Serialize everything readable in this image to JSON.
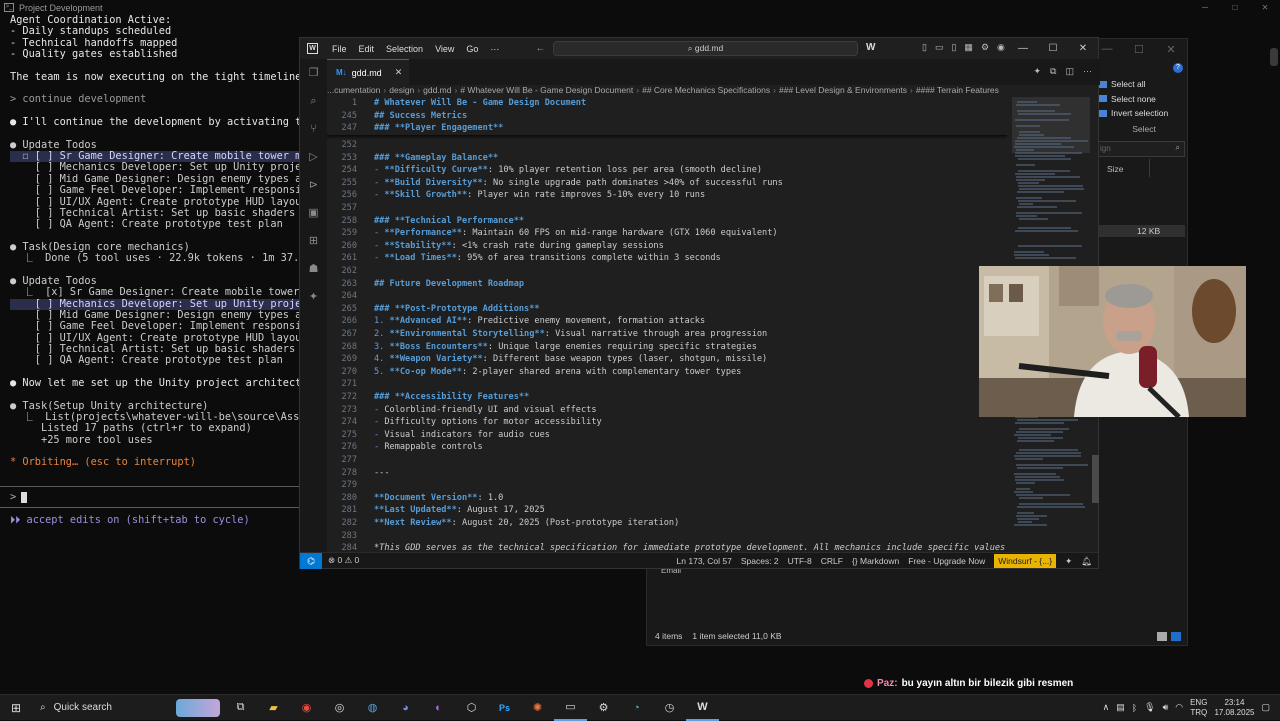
{
  "terminal": {
    "title": "Project Development",
    "lines": [
      {
        "text": "Agent Coordination Active:",
        "style": "white"
      },
      {
        "text": "- Daily standups scheduled",
        "style": "white"
      },
      {
        "text": "- Technical handoffs mapped",
        "style": "white"
      },
      {
        "text": "- Quality gates established",
        "style": "white"
      },
      {
        "text": "",
        "style": ""
      },
      {
        "text": "The team is now executing on the tight timeline with c",
        "style": "white"
      },
      {
        "text": "",
        "style": ""
      },
      {
        "text": "> continue development",
        "style": "dim"
      },
      {
        "text": "",
        "style": ""
      },
      {
        "text": "● I'll continue the development by activating the key ag",
        "style": "white"
      },
      {
        "text": "",
        "style": ""
      },
      {
        "text": "● Update Todos",
        "style": "green"
      },
      {
        "text": "  ☐ [ ] Sr Game Designer: Create mobile tower mechanics",
        "style": "hl"
      },
      {
        "text": "    [ ] Mechanics Developer: Set up Unity project archi",
        "style": ""
      },
      {
        "text": "    [ ] Mid Game Designer: Design enemy types and wave",
        "style": ""
      },
      {
        "text": "    [ ] Game Feel Developer: Implement responsive tower",
        "style": ""
      },
      {
        "text": "    [ ] UI/UX Agent: Create prototype HUD layout",
        "style": ""
      },
      {
        "text": "    [ ] Technical Artist: Set up basic shaders and visu",
        "style": ""
      },
      {
        "text": "    [ ] QA Agent: Create prototype test plan",
        "style": ""
      },
      {
        "text": "",
        "style": ""
      },
      {
        "text": "● Task(Design core mechanics)",
        "style": "green"
      },
      {
        "text": "  ⎿  Done (5 tool uses · 22.9k tokens · 1m 37.8s)",
        "style": ""
      },
      {
        "text": "",
        "style": ""
      },
      {
        "text": "● Update Todos",
        "style": "green"
      },
      {
        "text": "  ⎿  [x] Sr Game Designer: Create mobile tower mechanics",
        "style": "green"
      },
      {
        "text": "    [ ] Mechanics Developer: Set up Unity project archi",
        "style": "hl"
      },
      {
        "text": "    [ ] Mid Game Designer: Design enemy types and wave",
        "style": ""
      },
      {
        "text": "    [ ] Game Feel Developer: Implement responsive tower",
        "style": ""
      },
      {
        "text": "    [ ] UI/UX Agent: Create prototype HUD layout",
        "style": ""
      },
      {
        "text": "    [ ] Technical Artist: Set up basic shaders and visu",
        "style": ""
      },
      {
        "text": "    [ ] QA Agent: Create prototype test plan",
        "style": ""
      },
      {
        "text": "",
        "style": ""
      },
      {
        "text": "● Now let me set up the Unity project architecture:",
        "style": "white"
      },
      {
        "text": "",
        "style": ""
      },
      {
        "text": "● Task(Setup Unity architecture)",
        "style": "green"
      },
      {
        "text": "  ⎿  List(projects\\whatever-will-be\\source\\Assets\\Script",
        "style": ""
      },
      {
        "text": "     Listed 17 paths (ctrl+r to expand)",
        "style": ""
      },
      {
        "text": "     +25 more tool uses",
        "style": ""
      },
      {
        "text": "",
        "style": ""
      },
      {
        "text": "* Orbiting… (esc to interrupt)",
        "style": "orange"
      }
    ],
    "prompt_symbol": ">",
    "hint": "⏵⏵ accept edits on (shift+tab to cycle)"
  },
  "explorer": {
    "select_all": "Select all",
    "select_none": "Select none",
    "invert_selection": "Invert selection",
    "select_group": "Select",
    "search_placeholder": "ign",
    "size_header": "Size",
    "selected_size": "12 KB",
    "email_label": "Email",
    "status_items": "4 items",
    "status_selected": "1 item selected  11,0 KB"
  },
  "vscode": {
    "menu": [
      "File",
      "Edit",
      "Selection",
      "View",
      "Go",
      "···"
    ],
    "command_center": "⌕ gdd.md",
    "tab_label": "gdd.md",
    "breadcrumb": [
      "...cumentation",
      "design",
      "gdd.md",
      "# Whatever Will Be - Game Design Document",
      "## Core Mechanics Specifications",
      "### Level Design & Environments",
      "#### Terrain Features"
    ],
    "sticky_lines": [
      {
        "n": "1",
        "parts": [
          {
            "t": "# Whatever Will Be - Game Design Document",
            "c": "h"
          }
        ]
      },
      {
        "n": "245",
        "parts": [
          {
            "t": "## Success Metrics",
            "c": "h"
          }
        ]
      },
      {
        "n": "247",
        "parts": [
          {
            "t": "### **Player Engagement**",
            "c": "h"
          }
        ]
      }
    ],
    "lines": [
      {
        "n": "252",
        "parts": []
      },
      {
        "n": "253",
        "parts": [
          {
            "t": "### **Gameplay Balance**",
            "c": "h"
          }
        ]
      },
      {
        "n": "254",
        "parts": [
          {
            "t": "- ",
            "c": "li"
          },
          {
            "t": "**Difficulty Curve**",
            "c": "bb"
          },
          {
            "t": ": 10% player retention loss per area (smooth decline)",
            "c": "tx"
          }
        ]
      },
      {
        "n": "255",
        "parts": [
          {
            "t": "- ",
            "c": "li"
          },
          {
            "t": "**Build Diversity**",
            "c": "bb"
          },
          {
            "t": ": No single upgrade path dominates >40% of successful runs",
            "c": "tx"
          }
        ]
      },
      {
        "n": "256",
        "parts": [
          {
            "t": "- ",
            "c": "li"
          },
          {
            "t": "**Skill Growth**",
            "c": "bb"
          },
          {
            "t": ": Player win rate improves 5-10% every 10 runs",
            "c": "tx"
          }
        ]
      },
      {
        "n": "257",
        "parts": []
      },
      {
        "n": "258",
        "parts": [
          {
            "t": "### **Technical Performance**",
            "c": "h"
          }
        ]
      },
      {
        "n": "259",
        "parts": [
          {
            "t": "- ",
            "c": "li"
          },
          {
            "t": "**Performance**",
            "c": "bb"
          },
          {
            "t": ": Maintain 60 FPS on mid-range hardware (GTX 1060 equivalent)",
            "c": "tx"
          }
        ]
      },
      {
        "n": "260",
        "parts": [
          {
            "t": "- ",
            "c": "li"
          },
          {
            "t": "**Stability**",
            "c": "bb"
          },
          {
            "t": ": <1% crash rate during gameplay sessions",
            "c": "tx"
          }
        ]
      },
      {
        "n": "261",
        "parts": [
          {
            "t": "- ",
            "c": "li"
          },
          {
            "t": "**Load Times**",
            "c": "bb"
          },
          {
            "t": ": 95% of area transitions complete within 3 seconds",
            "c": "tx"
          }
        ]
      },
      {
        "n": "262",
        "parts": []
      },
      {
        "n": "263",
        "parts": [
          {
            "t": "## Future Development Roadmap",
            "c": "h"
          }
        ]
      },
      {
        "n": "264",
        "parts": []
      },
      {
        "n": "265",
        "parts": [
          {
            "t": "### **Post-Prototype Additions**",
            "c": "h"
          }
        ]
      },
      {
        "n": "266",
        "parts": [
          {
            "t": "1. ",
            "c": "li"
          },
          {
            "t": "**Advanced AI**",
            "c": "bb"
          },
          {
            "t": ": Predictive enemy movement, formation attacks",
            "c": "tx"
          }
        ]
      },
      {
        "n": "267",
        "parts": [
          {
            "t": "2. ",
            "c": "li"
          },
          {
            "t": "**Environmental Storytelling**",
            "c": "bb"
          },
          {
            "t": ": Visual narrative through area progression",
            "c": "tx"
          }
        ]
      },
      {
        "n": "268",
        "parts": [
          {
            "t": "3. ",
            "c": "li"
          },
          {
            "t": "**Boss Encounters**",
            "c": "bb"
          },
          {
            "t": ": Unique large enemies requiring specific strategies",
            "c": "tx"
          }
        ]
      },
      {
        "n": "269",
        "parts": [
          {
            "t": "4. ",
            "c": "li"
          },
          {
            "t": "**Weapon Variety**",
            "c": "bb"
          },
          {
            "t": ": Different base weapon types (laser, shotgun, missile)",
            "c": "tx"
          }
        ]
      },
      {
        "n": "270",
        "parts": [
          {
            "t": "5. ",
            "c": "li"
          },
          {
            "t": "**Co-op Mode**",
            "c": "bb"
          },
          {
            "t": ": 2-player shared arena with complementary tower types",
            "c": "tx"
          }
        ]
      },
      {
        "n": "271",
        "parts": []
      },
      {
        "n": "272",
        "parts": [
          {
            "t": "### **Accessibility Features**",
            "c": "h"
          }
        ]
      },
      {
        "n": "273",
        "parts": [
          {
            "t": "- ",
            "c": "li"
          },
          {
            "t": "Colorblind-friendly UI and visual effects",
            "c": "tx"
          }
        ]
      },
      {
        "n": "274",
        "parts": [
          {
            "t": "- ",
            "c": "li"
          },
          {
            "t": "Difficulty options for motor accessibility",
            "c": "tx"
          }
        ]
      },
      {
        "n": "275",
        "parts": [
          {
            "t": "- ",
            "c": "li"
          },
          {
            "t": "Visual indicators for audio cues",
            "c": "tx"
          }
        ]
      },
      {
        "n": "276",
        "parts": [
          {
            "t": "- ",
            "c": "li"
          },
          {
            "t": "Remappable controls",
            "c": "tx"
          }
        ]
      },
      {
        "n": "277",
        "parts": []
      },
      {
        "n": "278",
        "parts": [
          {
            "t": "---",
            "c": "tx"
          }
        ]
      },
      {
        "n": "279",
        "parts": []
      },
      {
        "n": "280",
        "parts": [
          {
            "t": "**Document Version**",
            "c": "bb"
          },
          {
            "t": ": 1.0",
            "c": "tx"
          }
        ]
      },
      {
        "n": "281",
        "parts": [
          {
            "t": "**Last Updated**",
            "c": "bb"
          },
          {
            "t": ": August 17, 2025",
            "c": "tx"
          }
        ]
      },
      {
        "n": "282",
        "parts": [
          {
            "t": "**Next Review**",
            "c": "bb"
          },
          {
            "t": ": August 20, 2025 (Post-prototype iteration)",
            "c": "tx"
          }
        ]
      },
      {
        "n": "283",
        "parts": []
      },
      {
        "n": "284",
        "parts": [
          {
            "t": "*This GDD serves as the technical specification for immediate prototype development. All mechanics include specific values",
            "c": "it"
          }
        ]
      }
    ],
    "status": {
      "problems": "⊗ 0 ⚠ 0",
      "position": "Ln 173, Col 57",
      "spaces": "Spaces: 2",
      "encoding": "UTF-8",
      "eol": "CRLF",
      "language": "{} Markdown",
      "upgrade": "Free - Upgrade Now",
      "windsurf": "Windsurf - {...}"
    }
  },
  "chat": {
    "user": "Paz:",
    "message": "bu yayın altın bir bilezik gibi resmen"
  },
  "taskbar": {
    "search": "Quick search",
    "lang_top": "ENG",
    "lang_bottom": "TRQ",
    "time": "23:14",
    "date": "17.08.2025"
  },
  "colors": {
    "accent": "#0078d4",
    "windsurf": "#e8b400",
    "terminal_green": "#3fbf5f",
    "terminal_orange": "#e8843c"
  }
}
